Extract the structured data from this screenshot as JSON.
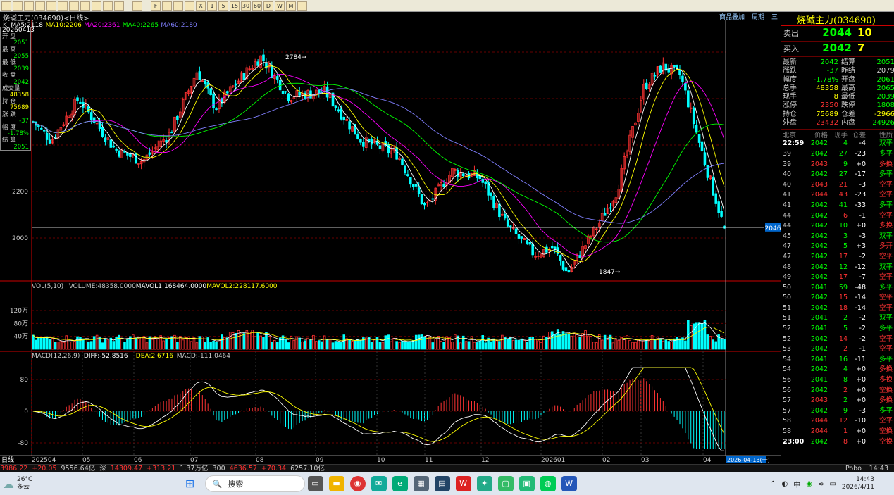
{
  "window": {
    "title": "烧碱主力(034690)<日线>",
    "links": [
      "商品叠加",
      "周期",
      "三"
    ]
  },
  "toolbar": {
    "icons": [
      "home-icon",
      "chart-icon",
      "chart-icon",
      "refresh-icon",
      "search-icon",
      "search-icon",
      "image-icon",
      "pen-icon",
      "eraser-icon",
      "filter-icon",
      "list-icon",
      "grid-icon",
      "box-icon",
      "box-icon",
      "box-icon",
      "box-icon",
      "box-icon",
      "box-icon",
      "box-icon",
      "box-icon",
      "box-icon",
      "box-icon",
      "box-icon",
      "box-icon",
      "box-icon",
      "box-icon"
    ],
    "labels": [
      "",
      "",
      "",
      "",
      "",
      "",
      "",
      "",
      "",
      "",
      "",
      "",
      "F",
      "",
      "",
      "",
      "X",
      "1",
      "5",
      "15",
      "30",
      "60",
      "D",
      "W",
      "M",
      ""
    ]
  },
  "infobox": {
    "date": "20260413",
    "rows": [
      {
        "k": "开 盘",
        "v": "2051",
        "c": "#0f0"
      },
      {
        "k": "最 高",
        "v": "2055",
        "c": "#0f0"
      },
      {
        "k": "最 低",
        "v": "2039",
        "c": "#0f0"
      },
      {
        "k": "收 盘",
        "v": "2042",
        "c": "#0f0"
      },
      {
        "k": "成交量",
        "v": "48358",
        "c": "#ff0"
      },
      {
        "k": "持 仓",
        "v": "75689",
        "c": "#ff0"
      },
      {
        "k": "涨 跌",
        "v": "-37",
        "c": "#0f0"
      },
      {
        "k": "幅 度",
        "v": "-1.78%",
        "c": "#0f0"
      },
      {
        "k": "结 算",
        "v": "2051",
        "c": "#0f0"
      }
    ]
  },
  "ma_legend": {
    "k": "K",
    "ma5": "MA5:2118",
    "ma10": "MA10:2206",
    "ma20": "MA20:2361",
    "ma40": "MA40:2265",
    "ma60": "MA60:2180",
    "colors": {
      "ma5": "#ffffff",
      "ma10": "#ffff00",
      "ma20": "#ff00ff",
      "ma40": "#00ff00",
      "ma60": "#8080ff"
    }
  },
  "vol_legend": {
    "a": "VOL(5,10)",
    "b": "VOLUME:48358.0000",
    "c": "MAVOL1:168464.0000",
    "d": "MAVOL2:228117.6000"
  },
  "macd_legend": {
    "a": "MACD(12,26,9)",
    "b": "DIFF:-52.8516",
    "c": "DEA:2.6716",
    "d": "MACD:-111.0464"
  },
  "price_axis": {
    "labels": [
      "2200",
      "2000"
    ],
    "current": "2046",
    "high_mark": "2784",
    "low_mark": "1847"
  },
  "vol_axis": {
    "labels": [
      "120万",
      "80万",
      "40万"
    ]
  },
  "macd_axis": {
    "labels": [
      "80",
      "0",
      "-80"
    ]
  },
  "date_axis": {
    "start": "日线",
    "labels": [
      "202504",
      "05",
      "06",
      "07",
      "08",
      "09",
      "10",
      "11",
      "12",
      "202601",
      "02",
      "03",
      "04"
    ],
    "cursor": "2026-04-13(一)"
  },
  "colors": {
    "up": "#ff3333",
    "down": "#00ffff",
    "accent": "#c00000"
  },
  "side": {
    "name": "烧碱主力(034690)",
    "sell": {
      "label": "卖出",
      "price": "2044",
      "qty": "10"
    },
    "buy": {
      "label": "买入",
      "price": "2042",
      "qty": "7"
    },
    "quote": [
      [
        "最新",
        "2042",
        "#0f0",
        "结算",
        "2051",
        "#0f0"
      ],
      [
        "涨跌",
        "-37",
        "#0f0",
        "昨结",
        "2079",
        "#ccc"
      ],
      [
        "幅度",
        "-1.78%",
        "#0f0",
        "开盘",
        "2061",
        "#0f0"
      ],
      [
        "总手",
        "48358",
        "#ff0",
        "最高",
        "2065",
        "#0f0"
      ],
      [
        "现手",
        "8",
        "#ff0",
        "最低",
        "2039",
        "#0f0"
      ],
      [
        "涨停",
        "2350",
        "#f33",
        "跌停",
        "1808",
        "#0f0"
      ],
      [
        "持仓",
        "75689",
        "#ff0",
        "仓差",
        "-2966",
        "#ff0"
      ],
      [
        "外盘",
        "23432",
        "#f33",
        "内盘",
        "24926",
        "#0f0"
      ]
    ],
    "ticks_header": [
      "北京",
      "价格",
      "现手",
      "仓差",
      "性质"
    ],
    "ticks": [
      [
        "22:59",
        "2042",
        "4",
        "-4",
        "双平"
      ],
      [
        "39",
        "2042",
        "27",
        "-23",
        "多平"
      ],
      [
        "39",
        "2043",
        "9",
        "+0",
        "多换"
      ],
      [
        "40",
        "2042",
        "27",
        "-17",
        "多平"
      ],
      [
        "40",
        "2043",
        "21",
        "-3",
        "空平"
      ],
      [
        "41",
        "2044",
        "43",
        "-23",
        "空平"
      ],
      [
        "41",
        "2042",
        "41",
        "-33",
        "多平"
      ],
      [
        "44",
        "2042",
        "6",
        "-1",
        "空平"
      ],
      [
        "44",
        "2042",
        "10",
        "+0",
        "多换"
      ],
      [
        "45",
        "2042",
        "3",
        "-3",
        "双平"
      ],
      [
        "47",
        "2042",
        "5",
        "+3",
        "多开"
      ],
      [
        "47",
        "2042",
        "17",
        "-2",
        "空平"
      ],
      [
        "48",
        "2042",
        "12",
        "-12",
        "双平"
      ],
      [
        "49",
        "2042",
        "17",
        "-7",
        "空平"
      ],
      [
        "50",
        "2041",
        "59",
        "-48",
        "多平"
      ],
      [
        "50",
        "2042",
        "15",
        "-14",
        "空平"
      ],
      [
        "51",
        "2042",
        "18",
        "-14",
        "空平"
      ],
      [
        "51",
        "2041",
        "2",
        "-2",
        "双平"
      ],
      [
        "52",
        "2041",
        "5",
        "-2",
        "多平"
      ],
      [
        "52",
        "2042",
        "14",
        "-2",
        "空平"
      ],
      [
        "53",
        "2042",
        "2",
        "-1",
        "空平"
      ],
      [
        "54",
        "2041",
        "16",
        "-11",
        "多平"
      ],
      [
        "54",
        "2042",
        "4",
        "+0",
        "多换"
      ],
      [
        "56",
        "2041",
        "8",
        "+0",
        "多换"
      ],
      [
        "56",
        "2042",
        "2",
        "+0",
        "空换"
      ],
      [
        "57",
        "2043",
        "2",
        "+0",
        "多换"
      ],
      [
        "57",
        "2042",
        "9",
        "-3",
        "多平"
      ],
      [
        "58",
        "2044",
        "12",
        "-10",
        "空平"
      ],
      [
        "58",
        "2044",
        "1",
        "+0",
        "空换"
      ],
      [
        "23:00",
        "2042",
        "8",
        "+0",
        "空换"
      ]
    ]
  },
  "statusbar": {
    "items": [
      "3986.22",
      "+20.05",
      "9556.64亿",
      "深",
      "14309.47",
      "+313.21",
      "1.37万亿",
      "300",
      "4636.57",
      "+70.34",
      "6257.10亿"
    ],
    "right": [
      "Pobo",
      "14:43"
    ]
  },
  "taskbar": {
    "weather_temp": "26°C",
    "weather_desc": "多云",
    "search": "搜索",
    "time": "14:43",
    "date": "2026/4/11",
    "ime": "中"
  }
}
